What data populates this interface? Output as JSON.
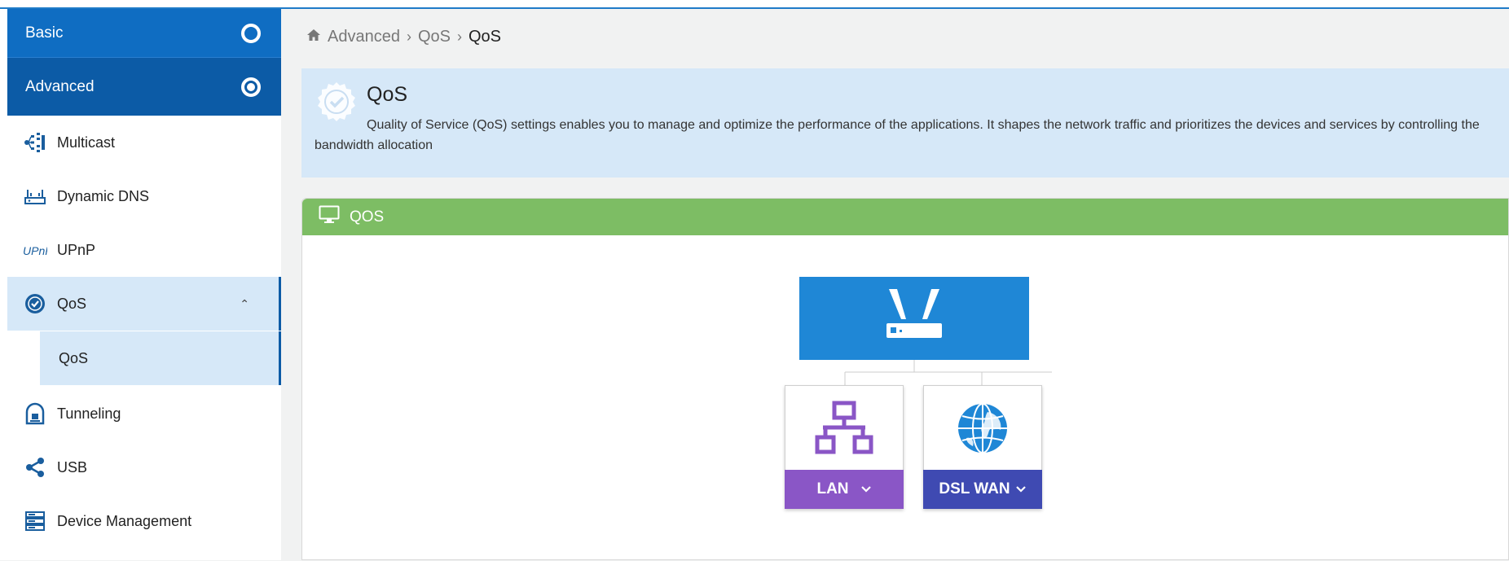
{
  "sidebar": {
    "basic_label": "Basic",
    "advanced_label": "Advanced",
    "items": [
      {
        "label": "Multicast",
        "icon": "multicast-icon"
      },
      {
        "label": "Dynamic DNS",
        "icon": "dynamic-dns-icon"
      },
      {
        "label": "UPnP",
        "icon": "upnp-icon"
      },
      {
        "label": "QoS",
        "icon": "qos-badge-icon"
      },
      {
        "label": "Tunneling",
        "icon": "tunneling-icon"
      },
      {
        "label": "USB",
        "icon": "share-icon"
      },
      {
        "label": "Device Management",
        "icon": "server-icon"
      }
    ],
    "sub_items": [
      {
        "label": "QoS"
      }
    ]
  },
  "breadcrumb": [
    "Advanced",
    "QoS",
    "QoS"
  ],
  "info": {
    "title": "QoS",
    "text": "Quality of Service (QoS) settings enables you to manage and optimize the performance of the applications. It shapes the network traffic and prioritizes the devices and services by controlling the bandwidth allocation"
  },
  "panel": {
    "title": "QOS",
    "cards": [
      {
        "label": "LAN",
        "icon": "lan-network-icon"
      },
      {
        "label": "DSL WAN",
        "icon": "globe-icon"
      }
    ]
  },
  "colors": {
    "primary": "#0f6dc2",
    "primary_dark": "#0c5ba6",
    "sidebar_active": "#d6e8f8",
    "panel_header": "#7dbd64",
    "router": "#1f87d6",
    "lan": "#8a56c6",
    "wan": "#3f4ab2"
  }
}
